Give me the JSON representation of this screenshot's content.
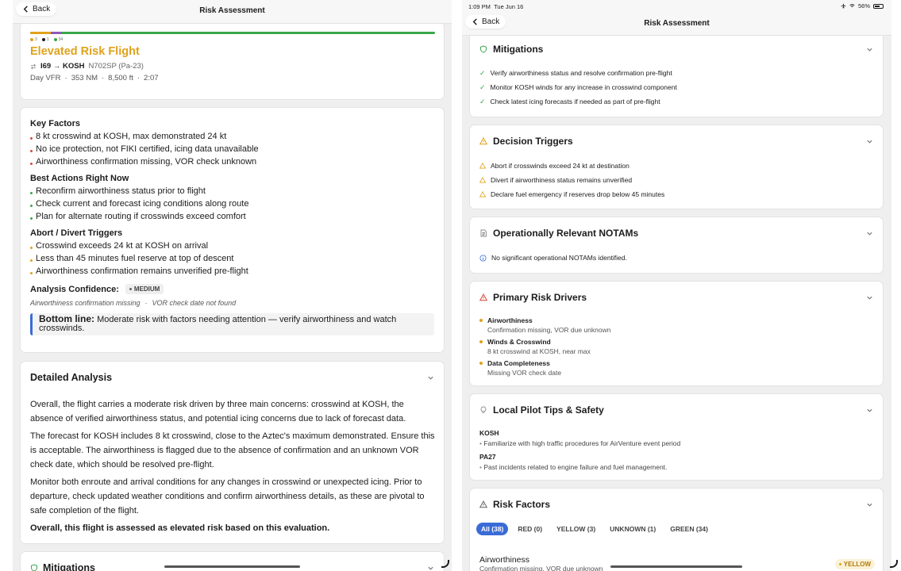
{
  "left": {
    "nav": {
      "back": "Back",
      "title": "Risk Assessment"
    },
    "summary": {
      "legend": [
        "3",
        "1",
        "34"
      ],
      "title": "Elevated Risk Flight",
      "route": "I69 → KOSH",
      "aircraft": "N702SP (Pa-23)",
      "details": [
        "Day VFR",
        "353 NM",
        "8,500 ft",
        "2:07"
      ]
    },
    "key_factors": {
      "title": "Key Factors",
      "items": [
        "8 kt crosswind at KOSH, max demonstrated 24 kt",
        "No ice protection, not FIKI certified, icing data unavailable",
        "Airworthiness confirmation missing, VOR check unknown"
      ]
    },
    "best_actions": {
      "title": "Best Actions Right Now",
      "items": [
        "Reconfirm airworthiness status prior to flight",
        "Check current and forecast icing conditions along route",
        "Plan for alternate routing if crosswinds exceed comfort"
      ]
    },
    "abort": {
      "title": "Abort / Divert Triggers",
      "items": [
        "Crosswind exceeds 24 kt at KOSH on arrival",
        "Less than 45 minutes fuel reserve at top of descent",
        "Airworthiness confirmation remains unverified pre-flight"
      ]
    },
    "confidence": {
      "label": "Analysis Confidence:",
      "value": "MEDIUM",
      "notes": [
        "Airworthiness confirmation missing",
        "VOR check date not found"
      ]
    },
    "bottom": {
      "label": "Bottom line:",
      "text": "Moderate risk with factors needing attention — verify airworthiness and watch crosswinds."
    },
    "detailed": {
      "title": "Detailed Analysis",
      "paragraphs": [
        "Overall, the flight carries a moderate risk driven by three main concerns: crosswind at KOSH, the absence of verified airworthiness status, and potential icing concerns due to lack of forecast data.",
        "The forecast for KOSH includes 8 kt crosswind, close to the Aztec's maximum demonstrated. Ensure this is acceptable. The airworthiness is flagged due to the absence of confirmation and an unknown VOR check date, which should be resolved pre-flight.",
        "Monitor both enroute and arrival conditions for any changes in crosswind or unexpected icing. Prior to departure, check updated weather conditions and confirm airworthiness details, as these are pivotal to safe completion of the flight."
      ],
      "conclusion": "Overall, this flight is assessed as elevated risk based on this evaluation."
    },
    "mitigations_title": "Mitigations"
  },
  "right": {
    "status": {
      "time": "1:09 PM",
      "date": "Tue Jun 16",
      "battery": "56%"
    },
    "nav": {
      "back": "Back",
      "title": "Risk Assessment"
    },
    "mitigations": {
      "title": "Mitigations",
      "items": [
        "Verify airworthiness status and resolve confirmation pre-flight",
        "Monitor KOSH winds for any increase in crosswind component",
        "Check latest icing forecasts if needed as part of pre-flight"
      ]
    },
    "decision": {
      "title": "Decision Triggers",
      "items": [
        "Abort if crosswinds exceed 24 kt at destination",
        "Divert if airworthiness status remains unverified",
        "Declare fuel emergency if reserves drop below 45 minutes"
      ]
    },
    "notams": {
      "title": "Operationally Relevant NOTAMs",
      "text": "No significant operational NOTAMs identified."
    },
    "drivers": {
      "title": "Primary Risk Drivers",
      "items": [
        {
          "name": "Airworthiness",
          "desc": "Confirmation missing, VOR due unknown"
        },
        {
          "name": "Winds & Crosswind",
          "desc": "8 kt crosswind at KOSH, near max"
        },
        {
          "name": "Data Completeness",
          "desc": "Missing VOR check date"
        }
      ]
    },
    "tips": {
      "title": "Local Pilot Tips & Safety",
      "groups": [
        {
          "airport": "KOSH",
          "tip": "Familiarize with high traffic procedures for AirVenture event period"
        },
        {
          "airport": "PA27",
          "tip": "Past incidents related to engine failure and fuel management."
        }
      ]
    },
    "risk_factors": {
      "title": "Risk Factors",
      "filters": [
        "All (38)",
        "RED (0)",
        "YELLOW (3)",
        "UNKNOWN (1)",
        "GREEN (34)"
      ],
      "first_item": {
        "name": "Airworthiness",
        "desc": "Confirmation missing, VOR due unknown",
        "badge": "YELLOW"
      }
    }
  },
  "colors": {
    "accent": "#e0a21b",
    "green": "#3aa64a",
    "red": "#d94a3d",
    "blue": "#3a6bd6",
    "purple": "#8e5bb8"
  }
}
